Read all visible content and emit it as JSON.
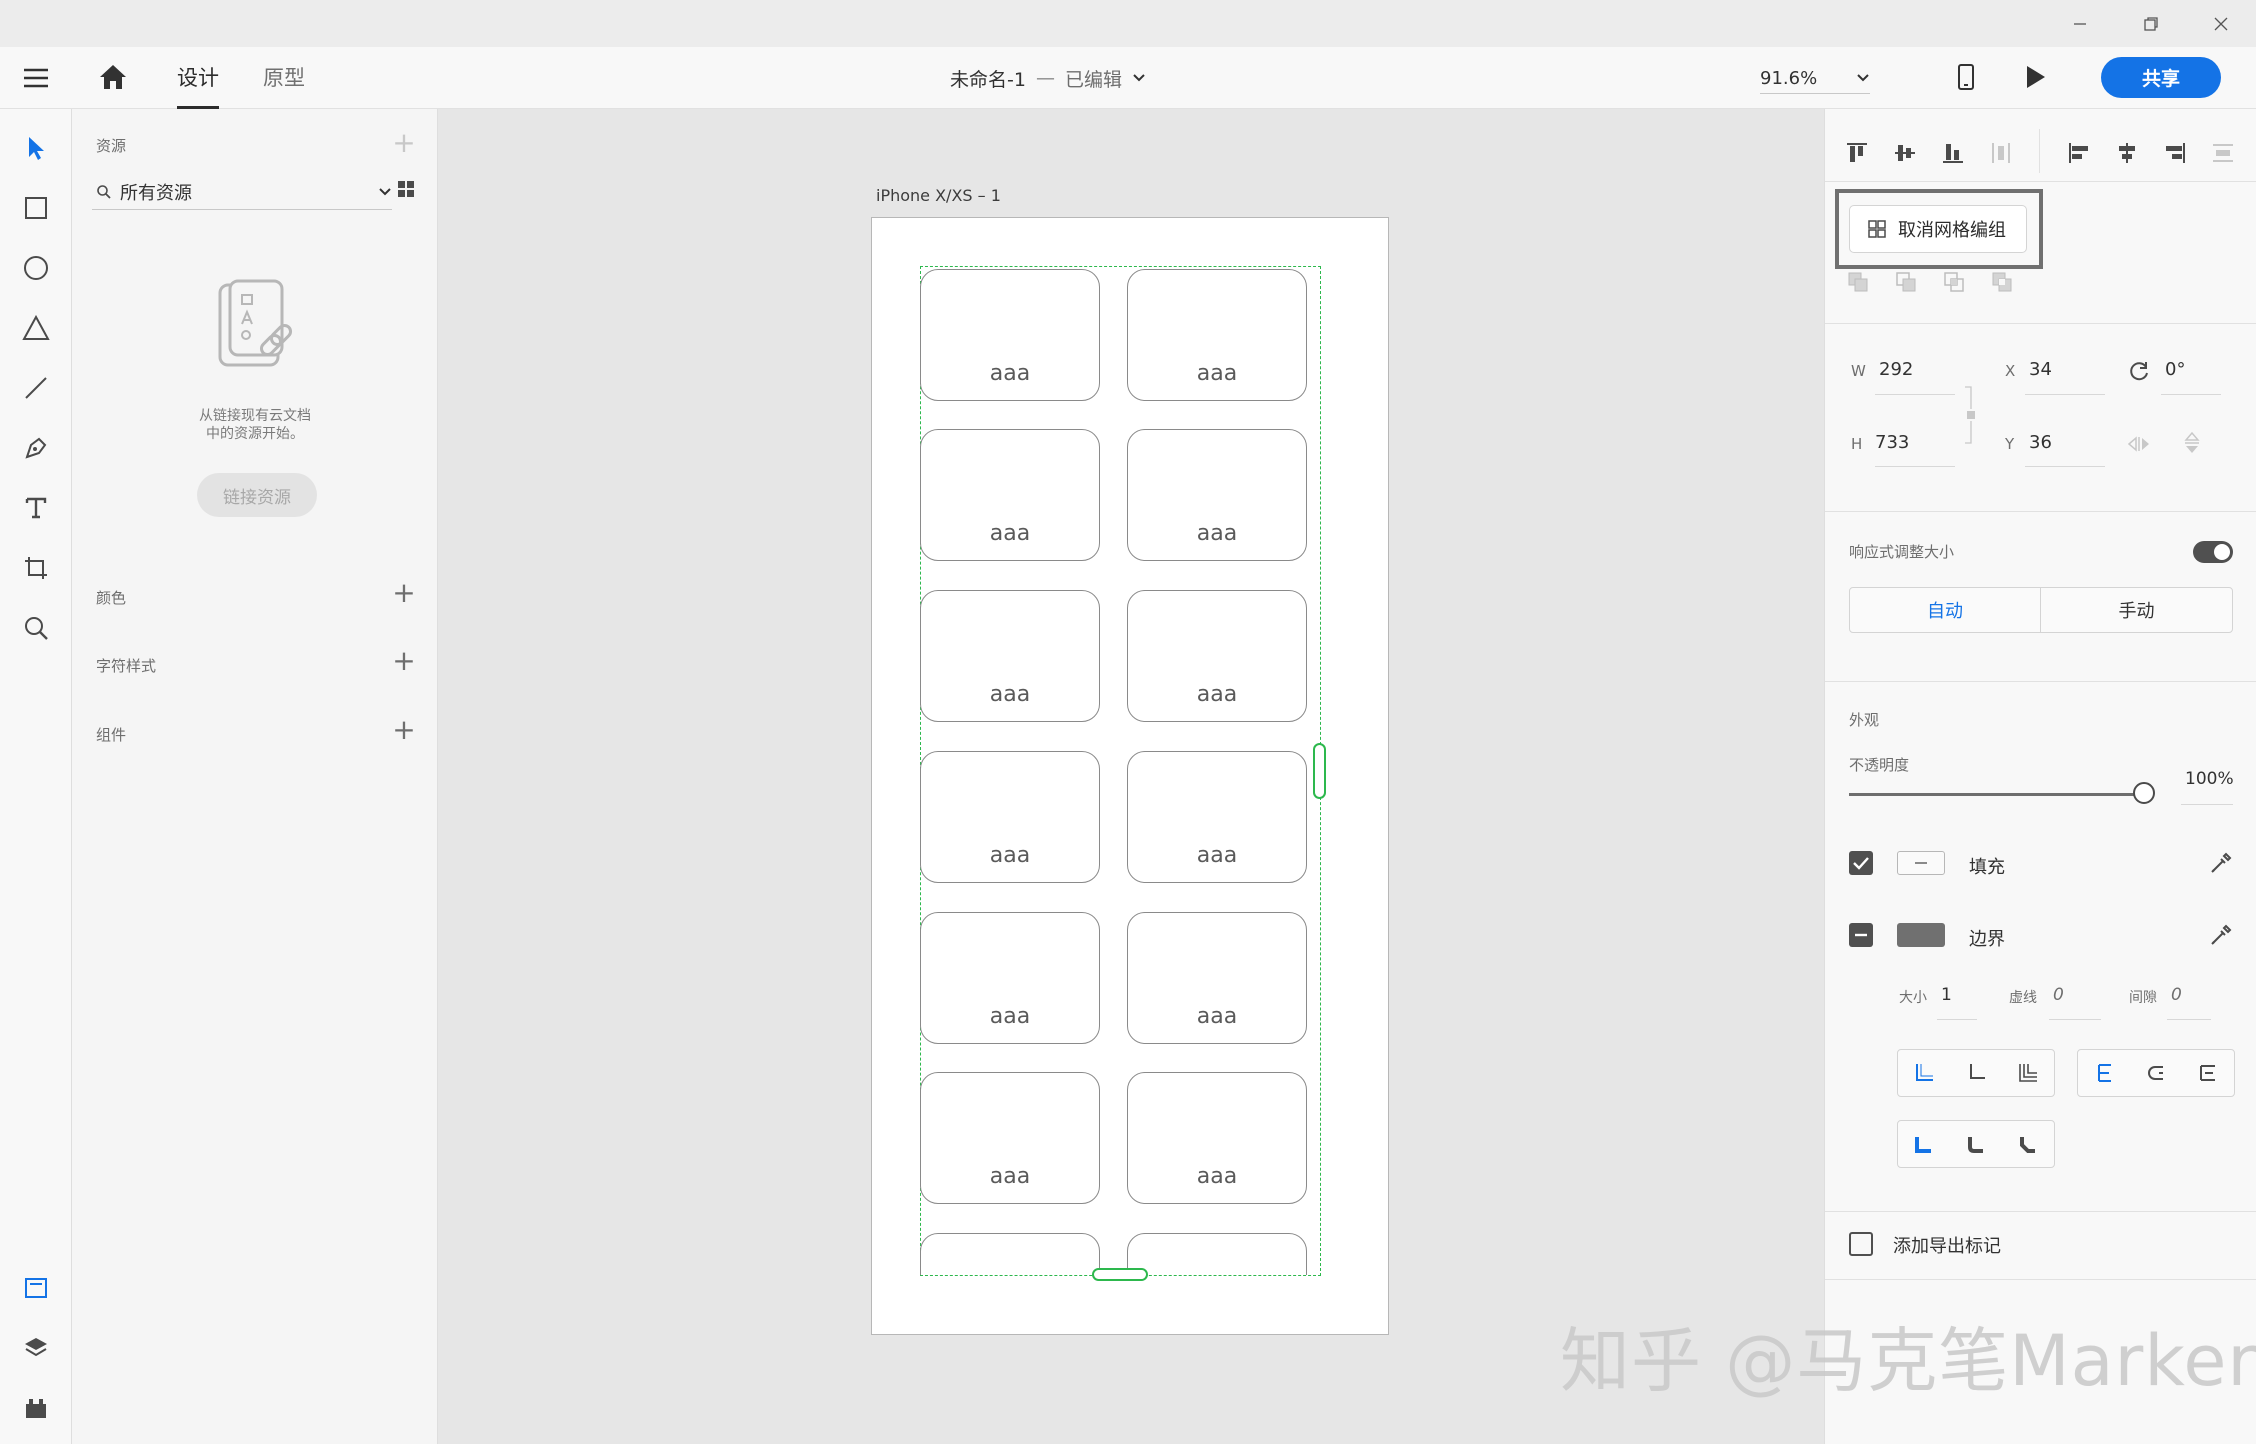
{
  "topbar": {
    "tab_design": "设计",
    "tab_prototype": "原型",
    "document_title": "未命名-1",
    "title_separator": "—",
    "edit_status": "已编辑",
    "zoom": "91.6%",
    "share_label": "共享"
  },
  "assets": {
    "header": "资源",
    "search_value": "所有资源",
    "empty_text_line1": "从链接现有云文档",
    "empty_text_line2": "中的资源开始。",
    "link_button": "链接资源",
    "sections": [
      {
        "label": "颜色"
      },
      {
        "label": "字符样式"
      },
      {
        "label": "组件"
      }
    ]
  },
  "canvas": {
    "artboard_name": "iPhone X/XS – 1",
    "card_label": "aaa"
  },
  "properties": {
    "ungroup_grid_button": "取消网格编组",
    "w_label": "W",
    "w_value": "292",
    "h_label": "H",
    "h_value": "733",
    "x_label": "X",
    "x_value": "34",
    "y_label": "Y",
    "y_value": "36",
    "rotation": "0°",
    "responsive_resize": "响应式调整大小",
    "auto": "自动",
    "manual": "手动",
    "appearance": "外观",
    "opacity_label": "不透明度",
    "opacity_value": "100%",
    "fill_label": "填充",
    "border_label": "边界",
    "size_label": "大小",
    "size_value": "1",
    "dash_label": "虚线",
    "dash_value": "0",
    "gap_label": "间隙",
    "gap_value": "0",
    "export_label": "添加导出标记"
  },
  "watermark": "知乎 @马克笔Marker",
  "colors": {
    "accent": "#1473e6",
    "grid_green": "#2db84d",
    "selection_blue": "#2680eb"
  }
}
